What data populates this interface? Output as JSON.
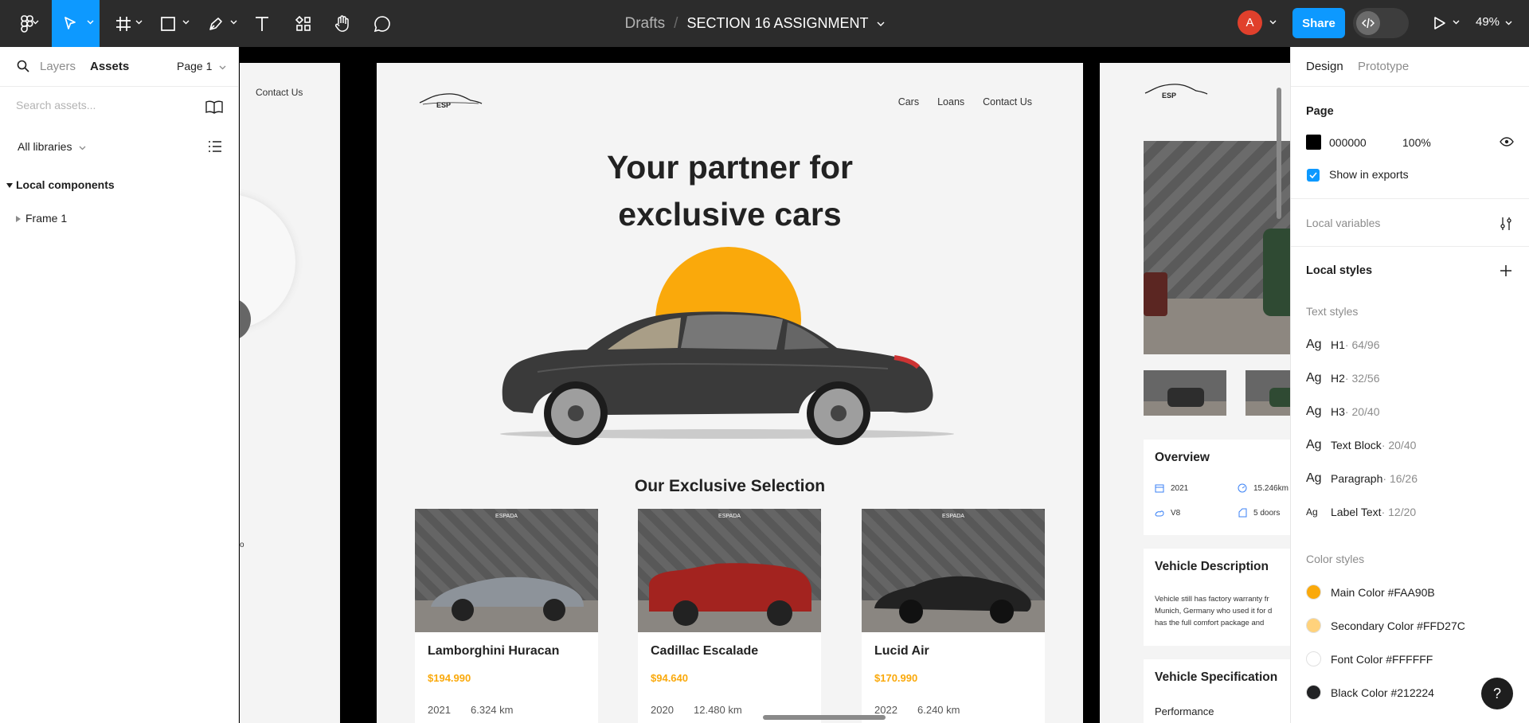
{
  "toolbar": {
    "breadcrumb_parent": "Drafts",
    "breadcrumb_sep": "/",
    "file_name": "SECTION 16 ASSIGNMENT",
    "avatar_initial": "A",
    "share_label": "Share",
    "zoom_label": "49%",
    "icons": [
      "figma-menu-icon",
      "move-tool-icon",
      "frame-tool-icon",
      "shape-tool-icon",
      "pen-tool-icon",
      "text-tool-icon",
      "resources-icon",
      "hand-tool-icon",
      "comment-icon",
      "dev-mode-icon",
      "present-icon"
    ]
  },
  "left_panel": {
    "tab_layers": "Layers",
    "tab_assets": "Assets",
    "page_selector": "Page 1",
    "search_placeholder": "Search assets...",
    "libraries_label": "All libraries",
    "section_label": "Local components",
    "items": [
      {
        "label": "Frame 1"
      }
    ]
  },
  "canvas": {
    "left_frame": {
      "contact": "Contact Us",
      "stray": "o"
    },
    "main_frame": {
      "logo": "ESP",
      "nav": [
        "Cars",
        "Loans",
        "Contact Us"
      ],
      "hero_line1": "Your partner for",
      "hero_line2": "exclusive cars",
      "selection_title": "Our Exclusive Selection",
      "brand_mark": "ESPADA",
      "cards": [
        {
          "name": "Lamborghini Huracan",
          "price": "$194.990",
          "year": "2021",
          "km": "6.324 km",
          "color": "#8d939a"
        },
        {
          "name": "Cadillac Escalade",
          "price": "$94.640",
          "year": "2020",
          "km": "12.480 km",
          "color": "#a3231f"
        },
        {
          "name": "Lucid Air",
          "price": "$170.990",
          "year": "2022",
          "km": "6.240 km",
          "color": "#222222"
        }
      ]
    },
    "right_frame": {
      "logo": "ESP",
      "overview_title": "Overview",
      "overview": {
        "year": "2021",
        "mileage": "15.246km",
        "engine": "V8",
        "doors": "5 doors"
      },
      "description_title": "Vehicle Description",
      "description_lines": [
        "Vehicle still has factory warranty fr",
        "Munich, Germany who used it for d",
        "has the full comfort package and"
      ],
      "spec_title": "Vehicle Specification",
      "spec_sub": "Performance"
    }
  },
  "right_panel": {
    "tab_design": "Design",
    "tab_prototype": "Prototype",
    "page_label": "Page",
    "page_color": "000000",
    "page_opacity": "100%",
    "show_exports": "Show in exports",
    "local_variables": "Local variables",
    "local_styles": "Local styles",
    "text_styles_label": "Text styles",
    "text_styles": [
      {
        "ag": "Ag",
        "name": "H1",
        "meta": " · 64/96"
      },
      {
        "ag": "Ag",
        "name": "H2",
        "meta": " · 32/56"
      },
      {
        "ag": "Ag",
        "name": "H3",
        "meta": " · 20/40"
      },
      {
        "ag": "Ag",
        "name": "Text Block",
        "meta": " · 20/40"
      },
      {
        "ag": "Ag",
        "name": "Paragraph",
        "meta": " · 16/26"
      },
      {
        "ag": "Ag",
        "name": "Label Text",
        "meta": " · 12/20"
      }
    ],
    "color_styles_label": "Color styles",
    "color_styles": [
      {
        "name": "Main Color #FAA90B",
        "hex": "#FAA90B"
      },
      {
        "name": "Secondary Color #FFD27C",
        "hex": "#FFD27C"
      },
      {
        "name": "Font Color #FFFFFF",
        "hex": "#FFFFFF"
      },
      {
        "name": "Black Color #212224",
        "hex": "#212224"
      }
    ],
    "help": "?"
  }
}
